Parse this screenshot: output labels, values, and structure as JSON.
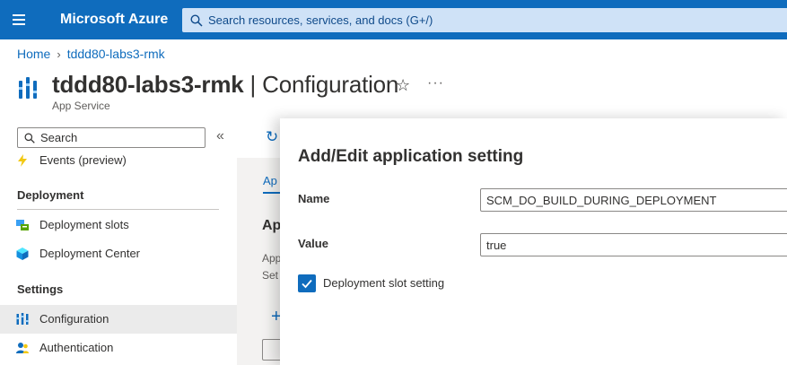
{
  "topbar": {
    "menu_icon": "hamburger-icon",
    "brand": "Microsoft Azure",
    "search_placeholder": "Search resources, services, and docs (G+/)"
  },
  "breadcrumb": {
    "items": [
      "Home",
      "tddd80-labs3-rmk"
    ]
  },
  "header": {
    "resource_name": "tddd80-labs3-rmk",
    "separator": " | ",
    "blade_name": "Configuration",
    "subtitle": "App Service",
    "favorite_icon": "star-icon",
    "more_icon": "ellipsis-icon"
  },
  "sidebar": {
    "search_placeholder": "Search",
    "collapse_icon": "double-chevron-left-icon",
    "items": [
      {
        "label": "Events (preview)",
        "icon": "lightning-icon"
      },
      {
        "label": "Deployment slots",
        "icon": "deployment-slots-icon"
      },
      {
        "label": "Deployment Center",
        "icon": "cube-icon"
      },
      {
        "label": "Configuration",
        "icon": "configuration-icon",
        "active": true
      },
      {
        "label": "Authentication",
        "icon": "people-icon"
      }
    ],
    "sections": [
      "Deployment",
      "Settings"
    ]
  },
  "background": {
    "tab_label": "Ap",
    "heading": "Ap",
    "text_line1": "App",
    "text_line2": "Set"
  },
  "panel": {
    "title": "Add/Edit application setting",
    "name_label": "Name",
    "name_value": "SCM_DO_BUILD_DURING_DEPLOYMENT",
    "value_label": "Value",
    "value_value": "true",
    "slot_setting_label": "Deployment slot setting",
    "slot_setting_checked": true
  },
  "colors": {
    "topbar": "#0f6cbd",
    "accent": "#0f6cbd",
    "active_nav": "#ebebeb"
  }
}
